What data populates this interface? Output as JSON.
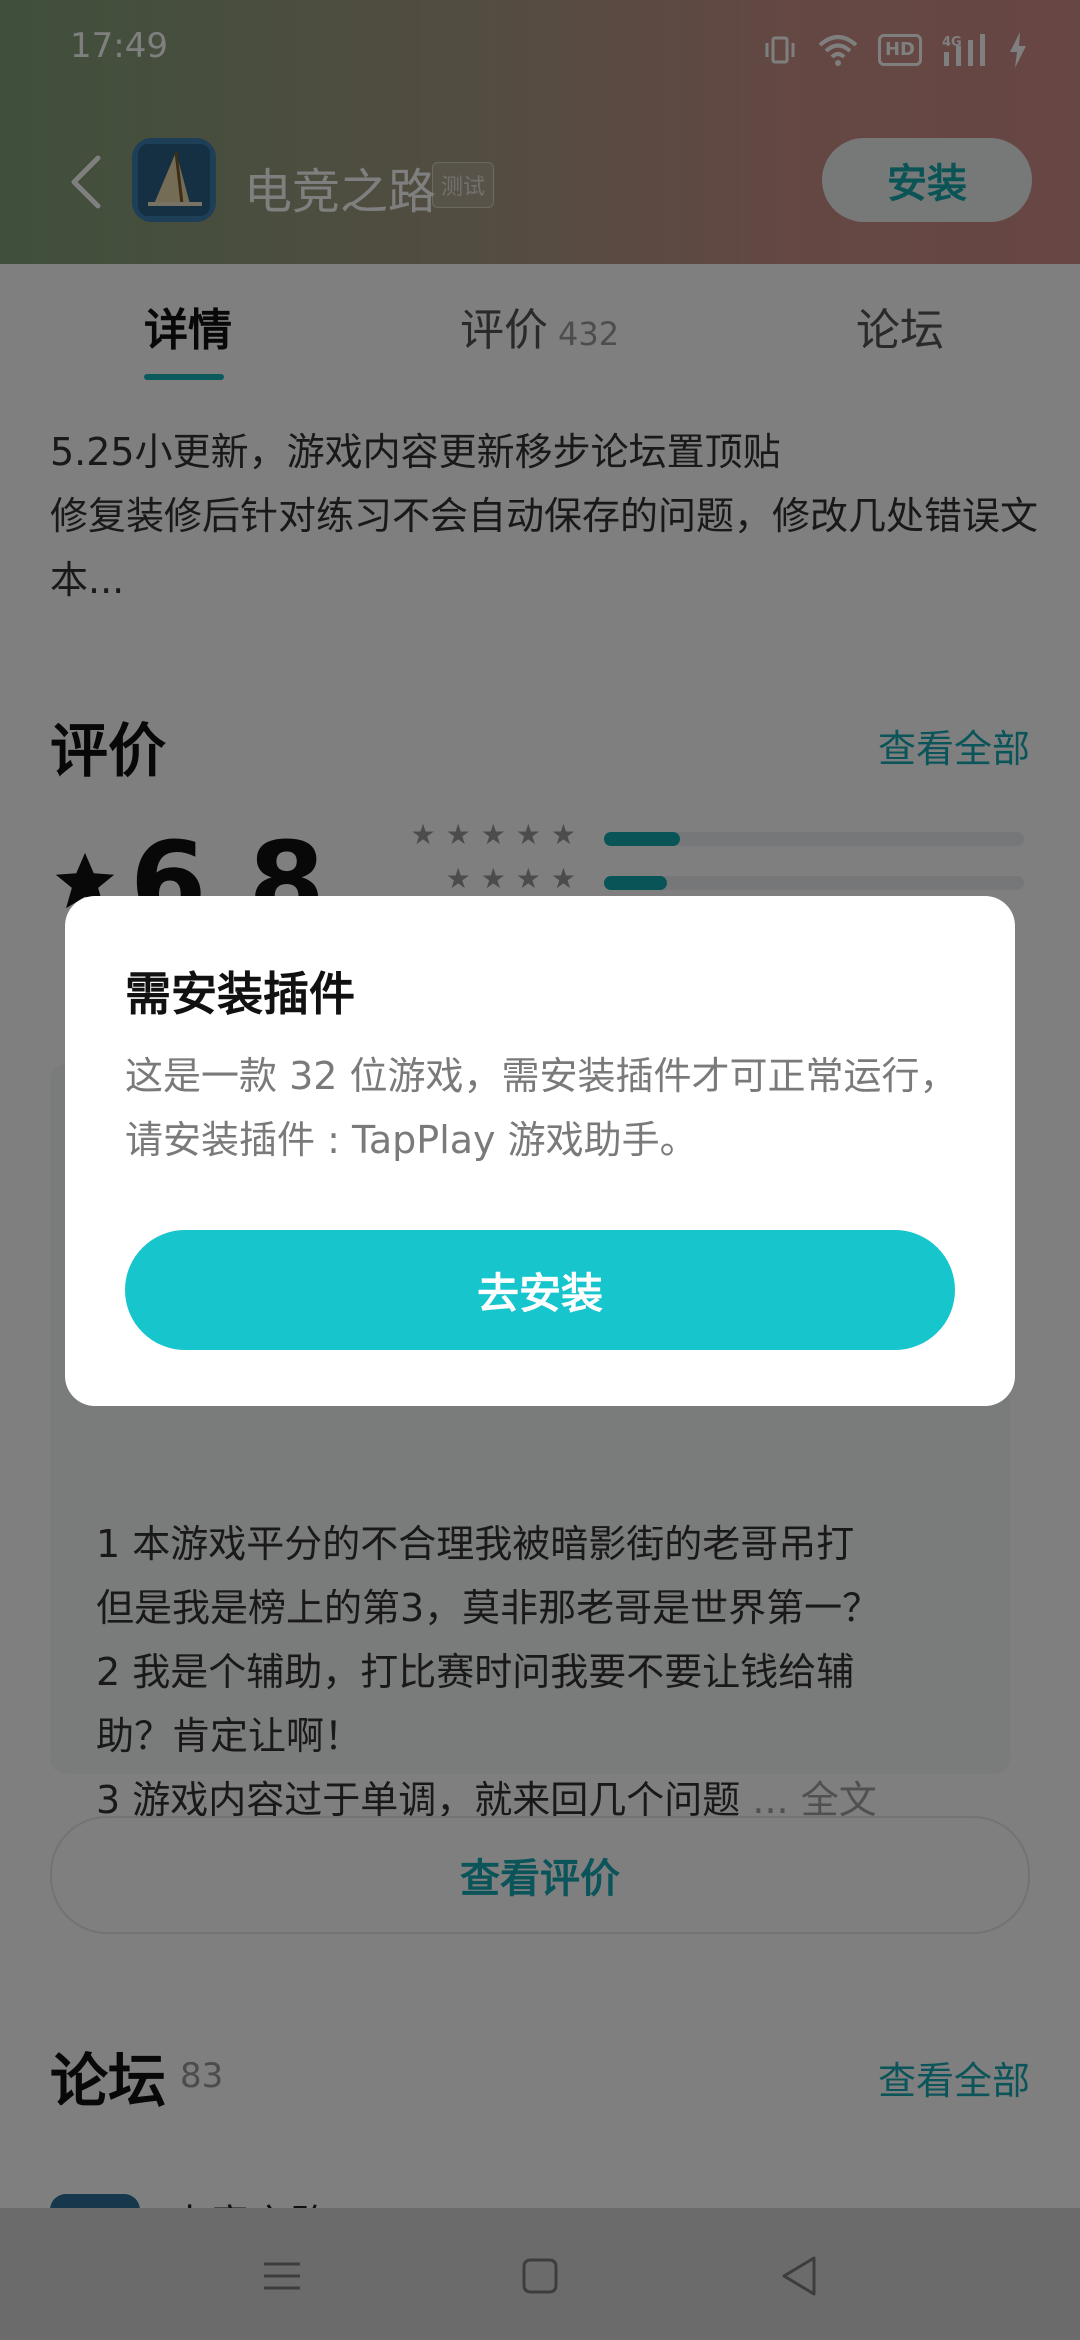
{
  "status_bar": {
    "time": "17:49",
    "hd_label": "HD",
    "network_label": "4G"
  },
  "header": {
    "app_name": "电竞之路",
    "test_badge": "测试",
    "install_label": "安装"
  },
  "tabs": [
    {
      "label": "详情"
    },
    {
      "label": "评价",
      "count": "432"
    },
    {
      "label": "论坛"
    }
  ],
  "update_notes": {
    "line1": "5.25小更新，游戏内容更新移步论坛置顶贴",
    "line2": "修复装修后针对练习不会自动保存的问题，修改几处错误文本..."
  },
  "reviews_section": {
    "title": "评价",
    "see_all": "查看全部",
    "score": "6.8",
    "star_bars": [
      {
        "stars": 5,
        "fraction": 0.18
      },
      {
        "stars": 4,
        "fraction": 0.15
      }
    ]
  },
  "review_excerpt": {
    "line1": "1 本游戏平分的不合理我被暗影街的老哥吊打",
    "line2": "但是我是榜上的第3，莫非那老哥是世界第一？",
    "line3": "2 我是个辅助，打比赛时问我要不要让钱给辅",
    "line4": "助？肯定让啊！",
    "line5": "3 游戏内容过于单调，就来回几个问题",
    "ellipsis": "...",
    "full_text": "全文"
  },
  "view_reviews_button": "查看评价",
  "forum_section": {
    "title": "论坛",
    "count": "83",
    "see_all": "查看全部",
    "first_item": "电竞之路"
  },
  "dialog": {
    "title": "需安装插件",
    "message": "这是一款 32 位游戏，需安装插件才可正常运行，请安装插件 : TapPlay 游戏助手。",
    "button": "去安装"
  },
  "colors": {
    "accent": "#17c5cd",
    "link": "#17a9b2"
  },
  "icons": {
    "back": "chevron-left-icon",
    "vibrate": "vibrate-icon",
    "wifi": "wifi-icon",
    "signal": "signal-icon",
    "charging": "charging-icon",
    "nav_menu": "menu-icon",
    "nav_home": "home-square-icon",
    "nav_back": "back-triangle-icon"
  }
}
